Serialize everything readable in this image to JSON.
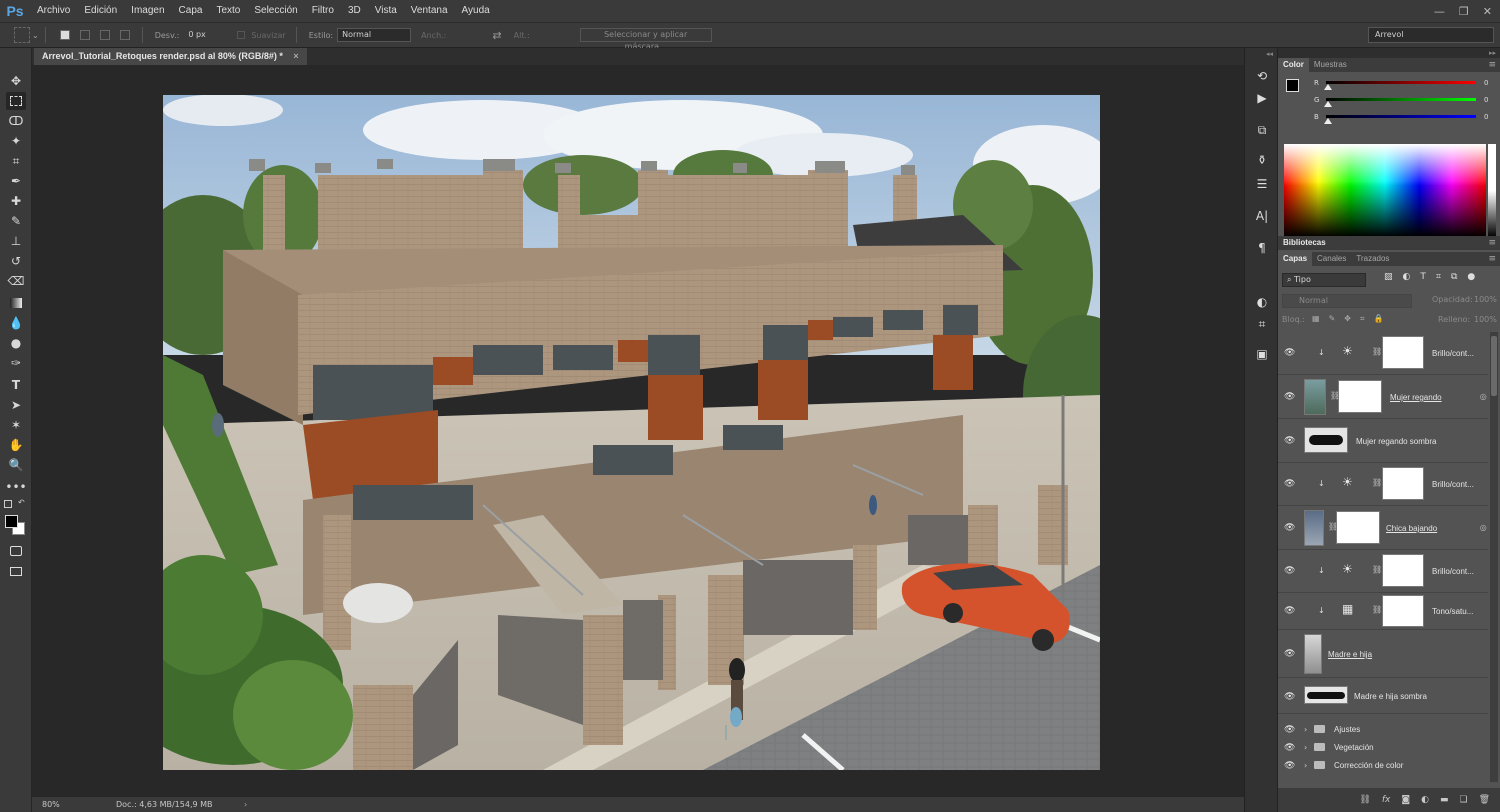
{
  "app": {
    "logo": "Ps"
  },
  "menu": [
    "Archivo",
    "Edición",
    "Imagen",
    "Capa",
    "Texto",
    "Selección",
    "Filtro",
    "3D",
    "Vista",
    "Ventana",
    "Ayuda"
  ],
  "window_controls": [
    "minimize-icon",
    "restore-icon",
    "close-icon"
  ],
  "options": {
    "feather_label": "Desv.:",
    "feather_value": "0 px",
    "antialias_label": "Suavizar",
    "style_label": "Estilo:",
    "style_value": "Normal",
    "width_label": "Anch.:",
    "height_label": "Alt.:",
    "select_mask_label": "Seleccionar y aplicar máscara...",
    "workspace_value": "Arrevol"
  },
  "document": {
    "tab_title": "Arrevol_Tutorial_Retoques render.psd al 80% (RGB/8#) *",
    "close_glyph": "×"
  },
  "status": {
    "zoom": "80%",
    "doc_info": "Doc.: 4,63 MB/154,9 MB",
    "arrow": "›"
  },
  "panels": {
    "color_tabs": [
      "Color",
      "Muestras"
    ],
    "color_sliders": [
      {
        "channel": "R",
        "value": "0",
        "gradient": [
          "#000000",
          "#ff0000"
        ]
      },
      {
        "channel": "G",
        "value": "0",
        "gradient": [
          "#000000",
          "#00ff00"
        ]
      },
      {
        "channel": "B",
        "value": "0",
        "gradient": [
          "#000000",
          "#0000ff"
        ]
      }
    ],
    "libraries_title": "Bibliotecas",
    "layers_tabs": [
      "Capas",
      "Canales",
      "Trazados"
    ],
    "filter_kind": "Tipo",
    "blend_mode": "Normal",
    "opacity_label": "Opacidad:",
    "opacity_value": "100%",
    "lock_label": "Bloq.:",
    "fill_label": "Relleno:",
    "fill_value": "100%"
  },
  "layers": [
    {
      "name": "Brillo/cont...",
      "type": "adjustment",
      "adj_icon": "sun-icon",
      "clipped": true,
      "underline": false
    },
    {
      "name": "Mujer regando",
      "type": "smart",
      "clipped": false,
      "underline": true,
      "fx": true
    },
    {
      "name": "Mujer regando sombra",
      "type": "shadow",
      "clipped": false,
      "underline": false
    },
    {
      "name": "Brillo/cont...",
      "type": "adjustment",
      "adj_icon": "sun-icon",
      "clipped": true,
      "underline": false
    },
    {
      "name": "Chica bajando",
      "type": "smart",
      "clipped": false,
      "underline": true,
      "fx": true
    },
    {
      "name": "Brillo/cont...",
      "type": "adjustment",
      "adj_icon": "sun-icon",
      "clipped": true,
      "underline": false
    },
    {
      "name": "Tono/satu...",
      "type": "adjustment",
      "adj_icon": "hue-icon",
      "clipped": true,
      "underline": false
    },
    {
      "name": "Madre e hija",
      "type": "person",
      "clipped": false,
      "underline": true
    },
    {
      "name": "Madre e hija sombra",
      "type": "shadow",
      "clipped": false,
      "underline": false
    },
    {
      "name": "Ajustes",
      "type": "group"
    },
    {
      "name": "Vegetación",
      "type": "group"
    },
    {
      "name": "Corrección de color",
      "type": "group"
    }
  ],
  "colors": {
    "chrome": "#3a3a3a",
    "panel": "#535353",
    "workspace": "#282828",
    "brick": "#a99079",
    "orange_panel": "#9a4a22",
    "car": "#d4522c"
  }
}
